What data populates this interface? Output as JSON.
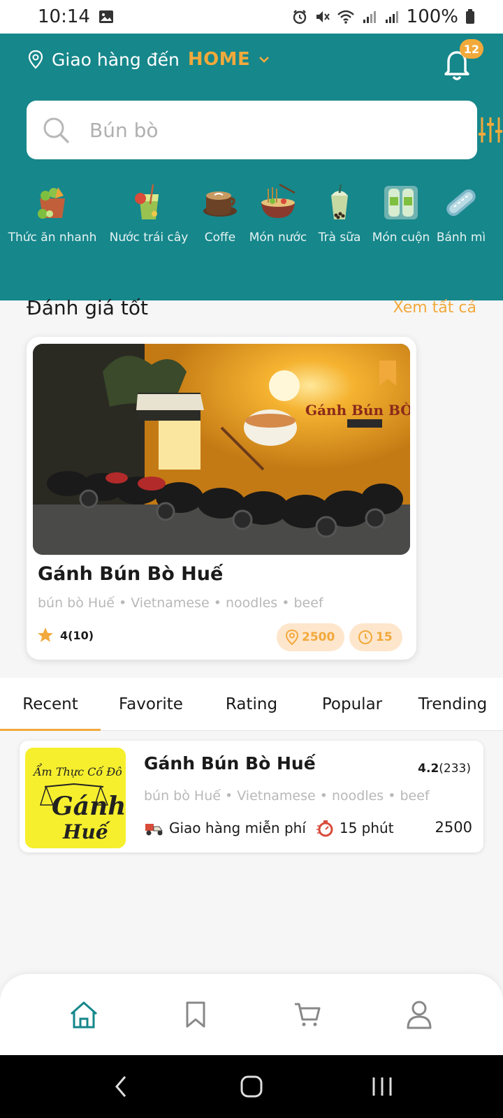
{
  "status_bar": {
    "time": "10:14",
    "battery": "100%"
  },
  "header": {
    "delivery_label": "Giao hàng đến",
    "delivery_location": "HOME",
    "notification_count": "12"
  },
  "search": {
    "placeholder": "Bún bò"
  },
  "categories": [
    {
      "label": "Thức ăn nhanh",
      "icon": "fast-food-icon"
    },
    {
      "label": "Nước trái cây",
      "icon": "juice-icon"
    },
    {
      "label": "Coffe",
      "icon": "coffee-icon"
    },
    {
      "label": "Món nước",
      "icon": "noodle-soup-icon"
    },
    {
      "label": "Trà sữa",
      "icon": "milk-tea-icon"
    },
    {
      "label": "Món cuộn",
      "icon": "roll-icon"
    },
    {
      "label": "Bánh mì",
      "icon": "bread-icon"
    }
  ],
  "top_rated": {
    "title": "Đánh giá tốt",
    "see_all": "Xem tất cả",
    "card": {
      "name": "Gánh Bún Bò Huế",
      "tags": "bún bò Huế • Vietnamese • noodles • beef",
      "rating": "4(10)",
      "distance": "2500",
      "time": "15",
      "sign_text": "Gánh Bún BÒ"
    }
  },
  "tabs": [
    {
      "label": "Recent",
      "active": true
    },
    {
      "label": "Favorite",
      "active": false
    },
    {
      "label": "Rating",
      "active": false
    },
    {
      "label": "Popular",
      "active": false
    },
    {
      "label": "Trending",
      "active": false
    }
  ],
  "list": [
    {
      "name": "Gánh Bún Bò Huế",
      "rating_value": "4.2",
      "rating_count": "(233)",
      "tags": "bún bò Huế • Vietnamese • noodles • beef",
      "delivery": "Giao hàng miễn phí",
      "time": "15 phút",
      "price": "2500",
      "logo_line1": "Ẩm Thực Cố Đô",
      "logo_line2": "Gánh",
      "logo_line3": "Huế"
    }
  ],
  "colors": {
    "primary": "#16878b",
    "accent": "#f2a93b",
    "pill_bg": "#fde6cc"
  }
}
